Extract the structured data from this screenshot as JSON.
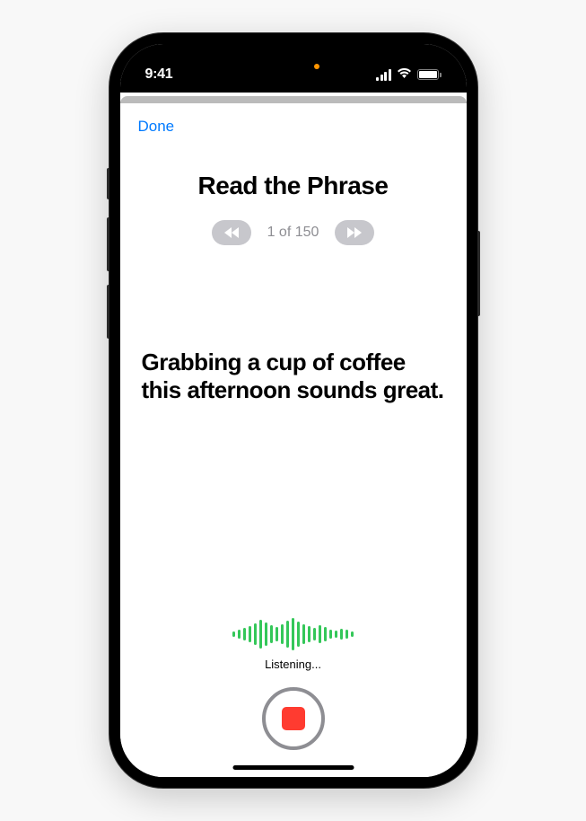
{
  "statusBar": {
    "time": "9:41"
  },
  "header": {
    "doneLabel": "Done"
  },
  "main": {
    "title": "Read the Phrase",
    "pageCounter": "1 of 150",
    "phrase": "Grabbing a cup of coffee this afternoon sounds great."
  },
  "recording": {
    "status": "Listening...",
    "waveformHeights": [
      6,
      10,
      14,
      18,
      24,
      32,
      26,
      20,
      16,
      22,
      30,
      36,
      28,
      22,
      18,
      14,
      20,
      16,
      10,
      8,
      12,
      10,
      6
    ]
  }
}
